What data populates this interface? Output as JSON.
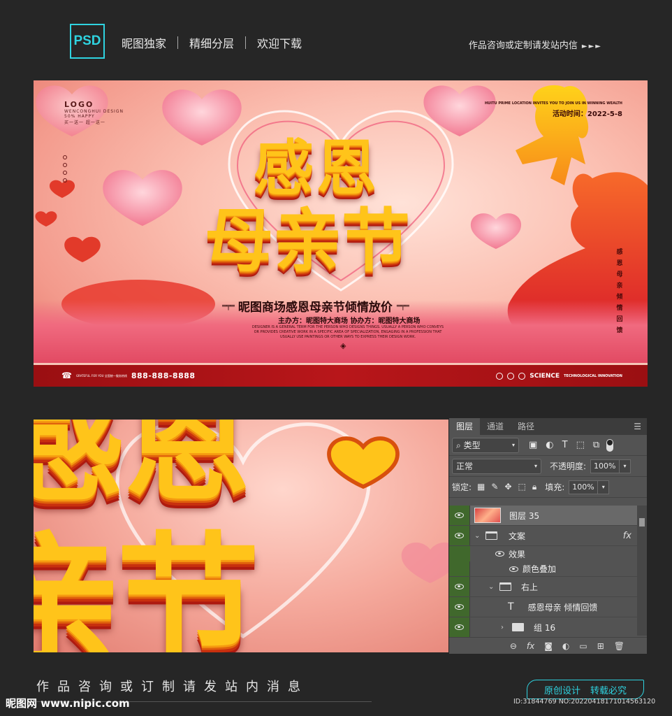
{
  "header": {
    "badge": "PSD",
    "tags": [
      "昵图独家",
      "精细分层",
      "欢迎下载"
    ],
    "right_text": "作品咨询或定制请发站内信",
    "arrows": "►►►"
  },
  "banner": {
    "logo": "LOGO",
    "logo_sub": "WENCONGHUI DESIGN",
    "logo_sale": "50% HAPPY",
    "logo_cn": "买一送一 超一送一",
    "title_line1": "感恩",
    "title_line2": "母亲节",
    "promo": "昵图商场感恩母亲节倾情放价",
    "organizer": "主办方：昵图特大商场  协办方：昵图特大商场",
    "english_body": "DESIGNER IS A GENERAL TERM FOR THE PERSON WHO DESIGNS THINGS. USUALLY A PERSON WHO CONVEYS OR PROVIDES CREATIVE WORK IN A SPECIFIC AREA OF SPECIALIZATION, ENGAGING IN A PROFESSION THAT USUALLY USE PAINTINGS OR OTHER WAYS TO EXPRESS THEIR DESIGN WORK.",
    "invite_en": "HUITU PRIME LOCATION INVITES YOU TO JOIN US IN WINNING WEALTH",
    "activity_time": "活动时间：2022-5-8",
    "vertical_text": "感恩母亲倾情回馈",
    "contact_small": "GRATEFUL FOR YOU 全国统一服务热线",
    "phone": "888-888-8888",
    "brand_right": "SCIENCE",
    "brand_right_small": "TECHNOLOGICAL INNOVATION"
  },
  "zoom": {
    "line1": "感恩",
    "line2": "亲节"
  },
  "layers_panel": {
    "tabs": [
      "图层",
      "通道",
      "路径"
    ],
    "active_tab": "图层",
    "filter_label": "类型",
    "blend_mode": "正常",
    "opacity_label": "不透明度:",
    "opacity_value": "100%",
    "lock_label": "锁定:",
    "fill_label": "填充:",
    "fill_value": "100%",
    "layers": [
      {
        "name": "图层 35",
        "type": "image",
        "selected": true
      },
      {
        "name": "文案",
        "type": "group-open",
        "fx": "fx"
      },
      {
        "name": "效果",
        "type": "effects"
      },
      {
        "name": "颜色叠加",
        "type": "effect"
      },
      {
        "name": "右上",
        "type": "group-open"
      },
      {
        "name": "感恩母亲 倾情回馈",
        "type": "text",
        "glyph": "T"
      },
      {
        "name": "组 16",
        "type": "group-closed"
      }
    ]
  },
  "footer": {
    "cta": "作品咨询或订制请发站内消息",
    "badge_left": "原创设计",
    "badge_right": "转载必究",
    "watermark": "昵图网 www.nipic.com",
    "id_text": "ID:31844769 NO:20220418171014563120"
  }
}
